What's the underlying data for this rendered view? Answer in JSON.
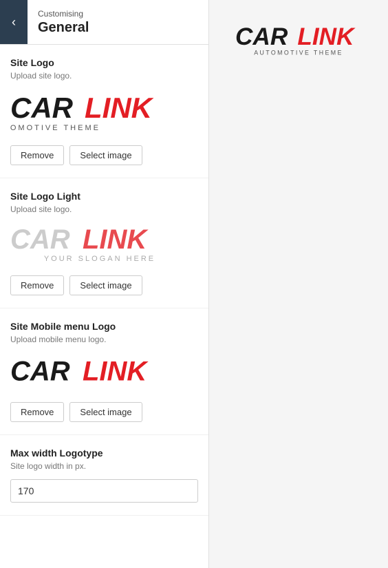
{
  "header": {
    "customising_label": "Customising",
    "general_label": "General",
    "back_icon": "‹"
  },
  "sections": {
    "site_logo": {
      "title": "Site Logo",
      "description": "Upload site logo.",
      "remove_label": "Remove",
      "select_label": "Select image"
    },
    "site_logo_light": {
      "title": "Site Logo Light",
      "description": "Upload site logo.",
      "remove_label": "Remove",
      "select_label": "Select image"
    },
    "site_mobile_logo": {
      "title": "Site Mobile menu Logo",
      "description": "Upload mobile menu logo.",
      "remove_label": "Remove",
      "select_label": "Select image"
    },
    "max_width": {
      "title": "Max width Logotype",
      "description": "Site logo width in px.",
      "value": "170"
    }
  }
}
